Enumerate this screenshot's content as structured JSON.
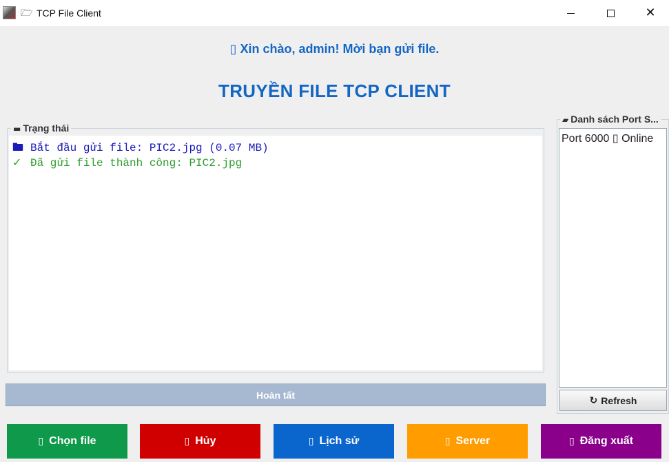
{
  "window": {
    "title": "TCP File Client",
    "folder_icon": "🗁",
    "close_glyph": "✕"
  },
  "header": {
    "greeting": "▯ Xin chào, admin! Mời bạn gửi file.",
    "title": "TRUYỀN FILE TCP CLIENT"
  },
  "status_panel": {
    "legend": "Trạng thái",
    "legend_icon": "scroll-icon",
    "log": [
      {
        "icon": "folder-open-icon",
        "glyph": "🖿",
        "text": "Bắt đầu gửi file: PIC2.jpg (0.07 MB)",
        "color": "#1a1ab8"
      },
      {
        "icon": "check-icon",
        "glyph": "✓",
        "text": "Đã gửi file thành công: PIC2.jpg",
        "color": "#2e9e2e"
      }
    ]
  },
  "progress": {
    "label": "Hoàn tất",
    "value": 100
  },
  "port_panel": {
    "legend": "Danh sách Port S...",
    "legend_icon": "satellite-icon",
    "items": [
      "Port 6000 ▯ Online"
    ],
    "refresh_label": "Refresh",
    "refresh_icon": "↻"
  },
  "actions": [
    {
      "label": "Chọn file",
      "glyph": "▯",
      "color": "#0e9a4a"
    },
    {
      "label": "Hủy",
      "glyph": "▯",
      "color": "#d00000"
    },
    {
      "label": "Lịch sử",
      "glyph": "▯",
      "color": "#0a66cc"
    },
    {
      "label": "Server",
      "glyph": "▯",
      "color": "#ff9c00"
    },
    {
      "label": "Đăng xuất",
      "glyph": "▯",
      "color": "#8a008a"
    }
  ]
}
